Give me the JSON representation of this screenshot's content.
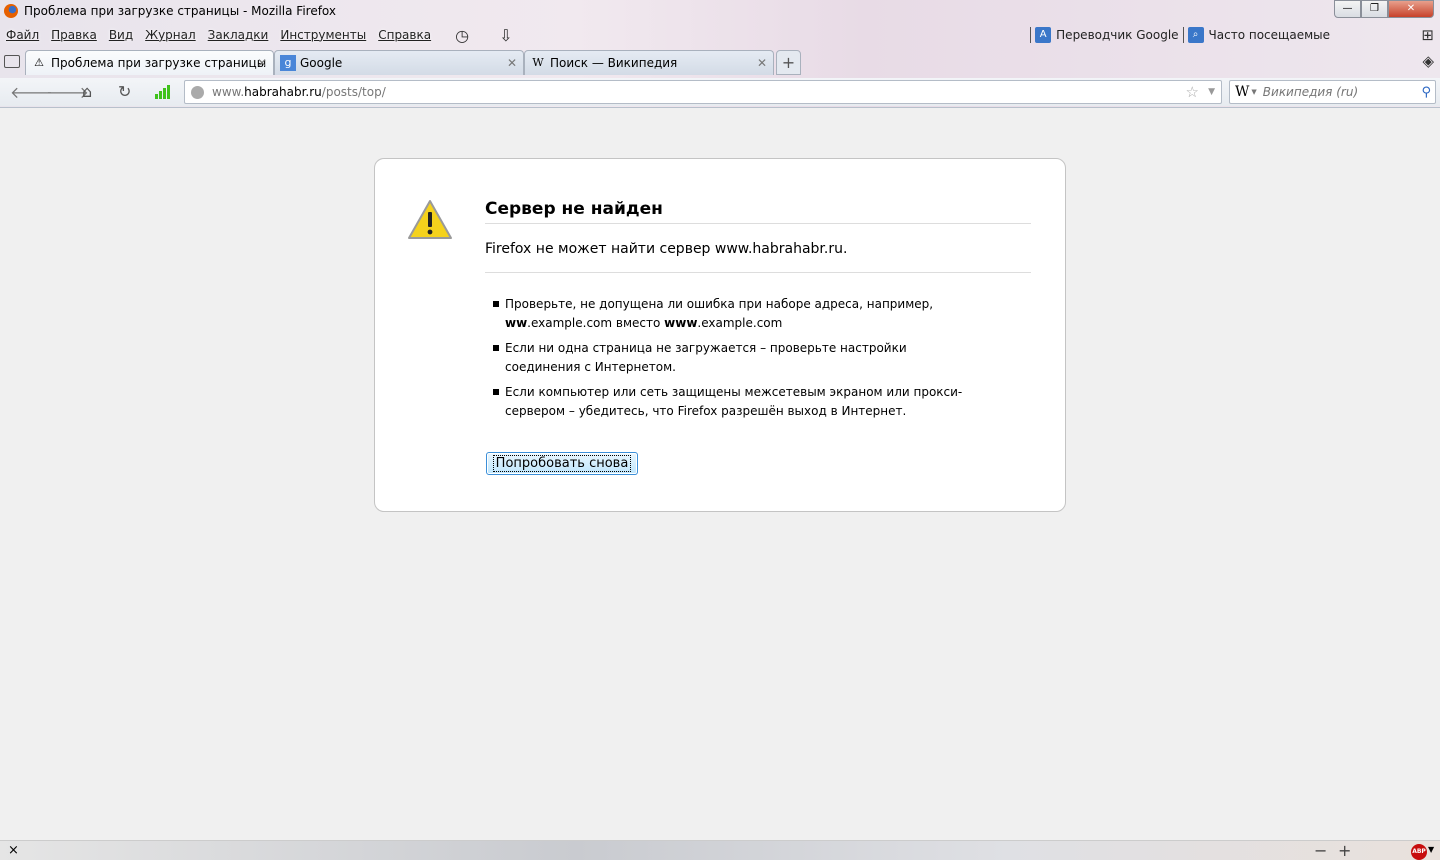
{
  "window": {
    "title": "Проблема при загрузке страницы - Mozilla Firefox",
    "minimize": "—",
    "maximize": "❐",
    "close": "✕"
  },
  "menu": [
    "Файл",
    "Правка",
    "Вид",
    "Журнал",
    "Закладки",
    "Инструменты",
    "Справка"
  ],
  "bookmarks": [
    {
      "label": "Переводчик Google",
      "icon": "google-translate-icon"
    },
    {
      "label": "Часто посещаемые",
      "icon": "frequent-icon"
    }
  ],
  "tabs": [
    {
      "title": "Проблема при загрузке страницы",
      "icon": "warning-icon",
      "active": true
    },
    {
      "title": "Google",
      "icon": "google-icon"
    },
    {
      "title": "Поиск — Википедия",
      "icon": "wikipedia-icon"
    }
  ],
  "navbar": {
    "url_host_prefix": "www.",
    "url_host": "habrahabr.ru",
    "url_path": "/posts/top/",
    "search_engine": "W",
    "search_placeholder": "Википедия (ru)"
  },
  "error": {
    "title": "Сервер не найден",
    "description": "Firefox не может найти сервер www.habrahabr.ru.",
    "items": [
      {
        "parts": [
          {
            "t": "Проверьте, не допущена ли ошибка при наборе адреса, например, "
          },
          {
            "t": "ww",
            "b": true
          },
          {
            "t": ".example.com вместо "
          },
          {
            "t": "www",
            "b": true
          },
          {
            "t": ".example.com"
          }
        ]
      },
      {
        "parts": [
          {
            "t": "Если ни одна страница не загружается – проверьте настройки соединения с Интернетом."
          }
        ]
      },
      {
        "parts": [
          {
            "t": "Если компьютер или сеть защищены межсетевым экраном или прокси-сервером – убедитесь, что Firefox разрешён выход в Интернет."
          }
        ]
      }
    ],
    "retry_label": "Попробовать снова"
  },
  "statusbar": {
    "close": "×",
    "zoom_out": "−",
    "zoom_in": "+",
    "abp": "ABP"
  }
}
